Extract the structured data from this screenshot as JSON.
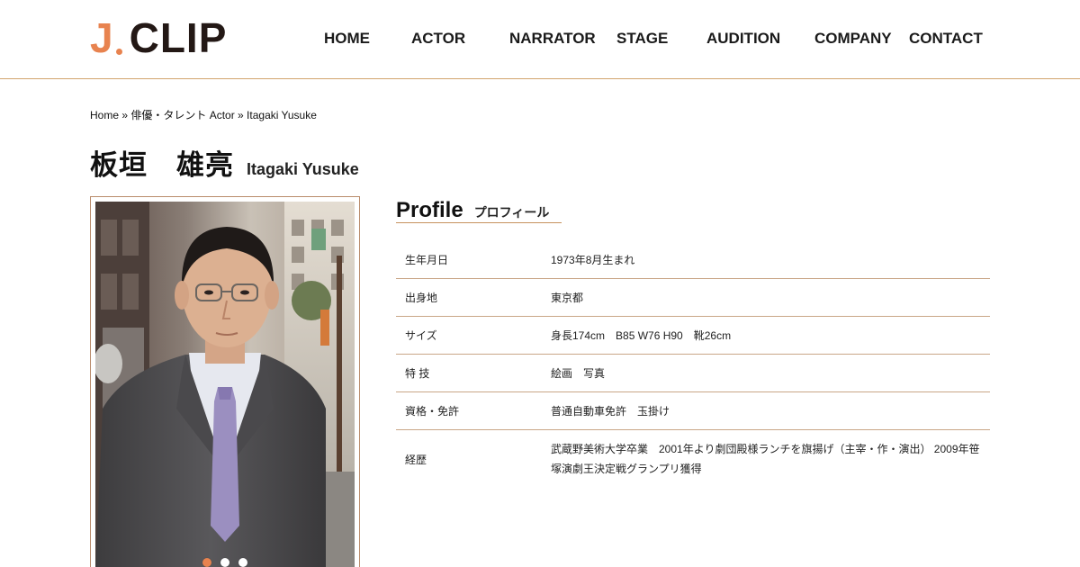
{
  "header": {
    "logo_j": "J",
    "logo_clip": "CLIP",
    "nav": [
      {
        "id": "home",
        "label": "HOME"
      },
      {
        "id": "actor",
        "label": "ACTOR"
      },
      {
        "id": "narrator",
        "label": "NARRATOR"
      },
      {
        "id": "stage",
        "label": "STAGE"
      },
      {
        "id": "audition",
        "label": "AUDITION"
      },
      {
        "id": "company",
        "label": "COMPANY"
      },
      {
        "id": "contact",
        "label": "CONTACT"
      }
    ]
  },
  "breadcrumb": {
    "home": "Home",
    "sep1": " » ",
    "category": "俳優・タレント Actor",
    "sep2": " » ",
    "current": "Itagaki Yusuke"
  },
  "title": {
    "ja": "板垣　雄亮",
    "en": "Itagaki Yusuke"
  },
  "slider": {
    "dots_count": 3,
    "active_index": 0
  },
  "profile": {
    "heading_en": "Profile",
    "heading_ja": "プロフィール",
    "rows": [
      {
        "label": "生年月日",
        "value": "1973年8月生まれ"
      },
      {
        "label": "出身地",
        "value": "東京都"
      },
      {
        "label": "サイズ",
        "value": "身長174cm　B85 W76 H90　靴26cm"
      },
      {
        "label": "特 技",
        "value": "絵画　写真"
      },
      {
        "label": "資格・免許",
        "value": "普通自動車免許　玉掛け"
      },
      {
        "label": "経歴",
        "value": "武蔵野美術大学卒業　2001年より劇団殿様ランチを旗揚げ（主宰・作・演出） 2009年笹塚演劇王決定戦グランプリ獲得"
      }
    ]
  },
  "colors": {
    "accent": "#e8834f",
    "rule": "#c9a687",
    "text": "#111111"
  }
}
